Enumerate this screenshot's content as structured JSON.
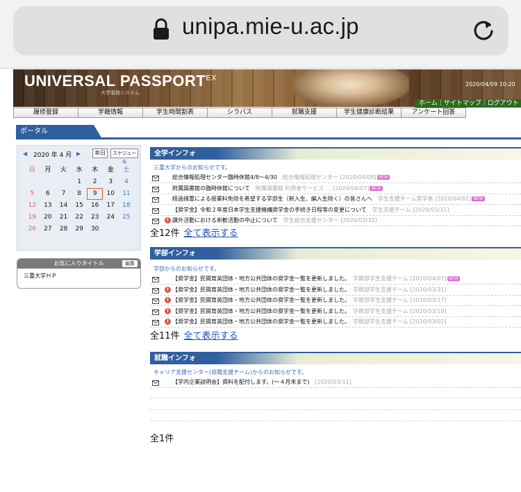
{
  "browser": {
    "url": "unipa.mie-u.ac.jp"
  },
  "banner": {
    "title": "UNIVERSAL PASSPORT",
    "title_sup": "EX",
    "subtitle": "大学事務システム",
    "datetime": "2020/04/09 10:20",
    "links": "ホーム｜サイトマップ｜ログアウト"
  },
  "nav": [
    "履修登録",
    "学籍情報",
    "学生時間割表",
    "シラバス",
    "就職支援",
    "学生健康診断結果",
    "アンケート回答"
  ],
  "portal": {
    "label": "ポータル"
  },
  "calendar": {
    "month_label": "2020 年 4 月",
    "today_button": "本日",
    "schedule_button": "スケジュール",
    "weekdays": [
      "日",
      "月",
      "火",
      "水",
      "木",
      "金",
      "土"
    ],
    "weeks": [
      [
        "",
        "",
        "",
        "1",
        "2",
        "3",
        "4"
      ],
      [
        "5",
        "6",
        "7",
        "8",
        "9",
        "10",
        "11"
      ],
      [
        "12",
        "13",
        "14",
        "15",
        "16",
        "17",
        "18"
      ],
      [
        "19",
        "20",
        "21",
        "22",
        "23",
        "24",
        "25"
      ],
      [
        "26",
        "27",
        "28",
        "29",
        "30",
        "",
        ""
      ]
    ],
    "today": "9"
  },
  "favorites": {
    "title": "お気に入りタイトル",
    "edit": "編集",
    "items": [
      "三重大学ＨＰ"
    ]
  },
  "sections": [
    {
      "title": "全学インフォ",
      "intro": "三重大学からのお知らせです。",
      "rows": [
        {
          "alert": false,
          "text": "総合情報処理センター臨時休館4/8～4/30",
          "source": "総合情報処理センター [2020/04/08]",
          "new": true
        },
        {
          "alert": false,
          "text": "附属図書館の臨時休館について",
          "source": "附属図書館 利用者サービス ... [2020/04/07]",
          "new": true
        },
        {
          "alert": false,
          "text": "経過措置による授業料免除を希望する学部生（新入生、編入生除く）の皆さんへ",
          "source": "学生支援チーム奨学係 [2020/04/02]",
          "new": true
        },
        {
          "alert": false,
          "text": "【奨学金】令和２年度日本学生支援機構奨学金の手続き日程等の変更について",
          "source": "学生支援チーム [2020/03/31]",
          "new": false
        },
        {
          "alert": true,
          "text": "課外活動における新歓活動の中止について",
          "source": "学生総合支援センター [2020/03/31]",
          "new": false
        }
      ],
      "total": "全12件",
      "show_all": "全て表示する"
    },
    {
      "title": "学部インフォ",
      "intro": "学部からのお知らせです。",
      "rows": [
        {
          "alert": false,
          "text": "【奨学金】民間育英団体・地方公共団体の奨学金一覧を更新しました。",
          "source": "学務部学生支援チーム [2020/04/07]",
          "new": true
        },
        {
          "alert": true,
          "text": "【奨学金】民間育英団体・地方公共団体の奨学金一覧を更新しました。",
          "source": "学務部学生支援チーム [2020/03/31]",
          "new": false
        },
        {
          "alert": true,
          "text": "【奨学金】民間育英団体・地方公共団体の奨学金一覧を更新しました。",
          "source": "学務部学生支援チーム [2020/03/17]",
          "new": false
        },
        {
          "alert": true,
          "text": "【奨学金】民間育英団体・地方公共団体の奨学金一覧を更新しました。",
          "source": "学務部学生支援チーム [2020/03/10]",
          "new": false
        },
        {
          "alert": true,
          "text": "【奨学金】民間育英団体・地方公共団体の奨学金一覧を更新しました。",
          "source": "学務部学生支援チーム [2020/03/02]",
          "new": false
        }
      ],
      "total": "全11件",
      "show_all": "全て表示する"
    },
    {
      "title": "就職インフォ",
      "intro": "キャリア支援センター(就職支援チーム)からのお知らせです。",
      "rows": [
        {
          "alert": false,
          "text": "【学内企業説明会】資料を配付します。(～４月末まで)",
          "source": "[2020/03/11]",
          "new": false
        }
      ],
      "total": "全1件"
    }
  ],
  "new_badge": "NEW",
  "colors": {
    "accent": "#2f5f9e",
    "link": "#1a4fb8",
    "alert": "#d45a4a"
  }
}
